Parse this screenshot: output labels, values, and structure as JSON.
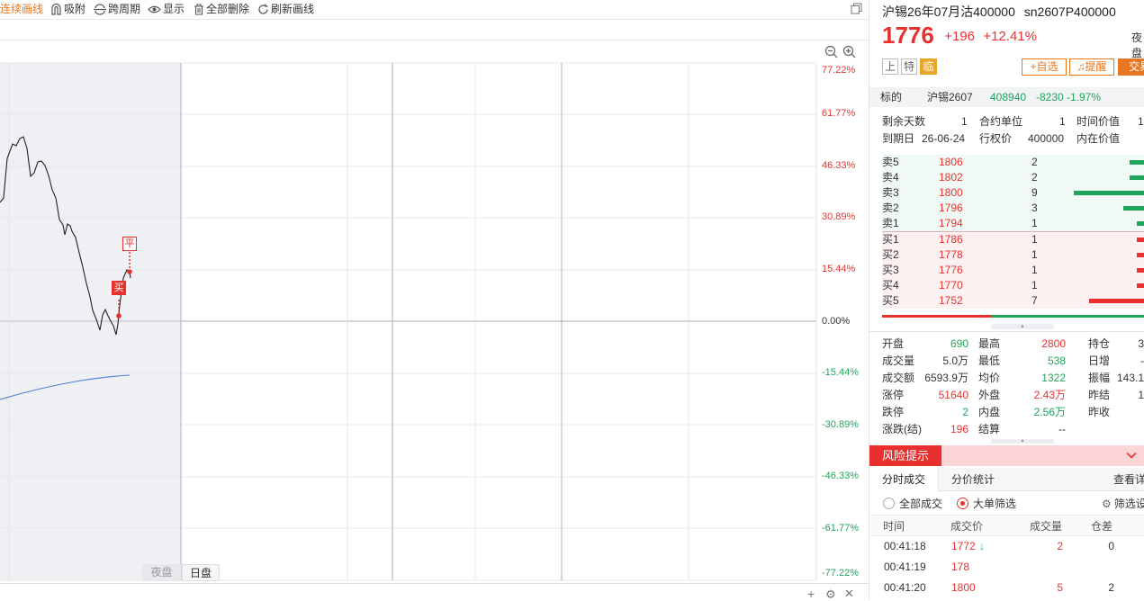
{
  "toolbar": {
    "continuous_draw": "连续画线",
    "snap": "吸附",
    "cross_period": "跨周期",
    "show": "显示",
    "delete_all": "全部删除",
    "refresh_draw": "刷新画线"
  },
  "chart": {
    "pct_labels": [
      "77.22%",
      "61.77%",
      "46.33%",
      "30.89%",
      "15.44%",
      "0.00%",
      "-15.44%",
      "-30.89%",
      "-46.33%",
      "-61.77%",
      "-77.22%"
    ],
    "session_tabs": {
      "night": "夜盘",
      "day": "日盘"
    },
    "marker_flat": "平",
    "marker_buy": "买",
    "colors": {
      "up": "#e8312f",
      "down": "#1fa55b",
      "price_line": "#222222",
      "avg_line": "#4a7fd6",
      "night_bg": "#eef0f4"
    }
  },
  "quote": {
    "name": "沪锡26年07月沽400000",
    "code": "sn2607P400000",
    "price": "1776",
    "change": "+196",
    "change_pct": "+12.41%",
    "night_label": "夜盘",
    "tags": [
      "上",
      "特",
      "临"
    ],
    "add_watch": "自选",
    "alert": "提醒",
    "trade": "交易"
  },
  "underlying": {
    "label": "标的",
    "name": "沪锡2607",
    "price": "408940",
    "change": "-8230",
    "change_pct": "-1.97%"
  },
  "contract_info": {
    "remaining_days_label": "剩余天数",
    "remaining_days": "1",
    "unit_label": "合约单位",
    "unit": "1",
    "time_value_label": "时间价值",
    "time_value": "1",
    "expiry_label": "到期日",
    "expiry": "26-06-24",
    "strike_label": "行权价",
    "strike": "400000",
    "intrinsic_label": "内在价值"
  },
  "order_book": {
    "asks": [
      {
        "label": "卖5",
        "price": "1806",
        "vol": "2",
        "bar": 0.2
      },
      {
        "label": "卖4",
        "price": "1802",
        "vol": "2",
        "bar": 0.2
      },
      {
        "label": "卖3",
        "price": "1800",
        "vol": "9",
        "bar": 1.0
      },
      {
        "label": "卖2",
        "price": "1796",
        "vol": "3",
        "bar": 0.3
      },
      {
        "label": "卖1",
        "price": "1794",
        "vol": "1",
        "bar": 0.1
      }
    ],
    "bids": [
      {
        "label": "买1",
        "price": "1786",
        "vol": "1",
        "bar": 0.1
      },
      {
        "label": "买2",
        "price": "1778",
        "vol": "1",
        "bar": 0.1
      },
      {
        "label": "买3",
        "price": "1776",
        "vol": "1",
        "bar": 0.1
      },
      {
        "label": "买4",
        "price": "1770",
        "vol": "1",
        "bar": 0.1
      },
      {
        "label": "买5",
        "price": "1752",
        "vol": "7",
        "bar": 0.78
      }
    ],
    "buy_ratio": 0.42
  },
  "stats": {
    "open_label": "开盘",
    "open": "690",
    "high_label": "最高",
    "high": "2800",
    "hold_label": "持仓",
    "hold": "3",
    "volume_label": "成交量",
    "volume": "5.0万",
    "low_label": "最低",
    "low": "538",
    "daily_inc_label": "日增",
    "daily_inc": "-",
    "amount_label": "成交额",
    "amount": "6593.9万",
    "avg_label": "均价",
    "avg": "1322",
    "amplitude_label": "振幅",
    "amplitude": "143.1",
    "limit_up_label": "涨停",
    "limit_up": "51640",
    "outer_label": "外盘",
    "outer": "2.43万",
    "prev_settle_label": "昨结",
    "prev_settle": "1",
    "limit_down_label": "跌停",
    "limit_down": "2",
    "inner_label": "内盘",
    "inner": "2.56万",
    "prev_close_label": "昨收",
    "change_settle_label": "涨跌(结)",
    "change_settle": "196",
    "settle_label": "结算",
    "settle": "--"
  },
  "risk": {
    "label": "风险提示"
  },
  "trades_panel": {
    "tab_tick": "分时成交",
    "tab_stats": "分价统计",
    "view_detail": "查看详",
    "filter_all": "全部成交",
    "filter_big": "大单筛选",
    "filter_btn": "筛选设",
    "headers": [
      "时间",
      "成交价",
      "成交量",
      "仓差"
    ],
    "rows": [
      {
        "time": "00:41:18",
        "price": "1772",
        "arrow": "↓",
        "vol": "2",
        "oi": "0"
      },
      {
        "time": "00:41:19",
        "price": "178",
        "arrow": "",
        "vol": "",
        "oi": ""
      },
      {
        "time": "00:41:20",
        "price": "1800",
        "arrow": "",
        "vol": "5",
        "oi": "2"
      }
    ]
  }
}
